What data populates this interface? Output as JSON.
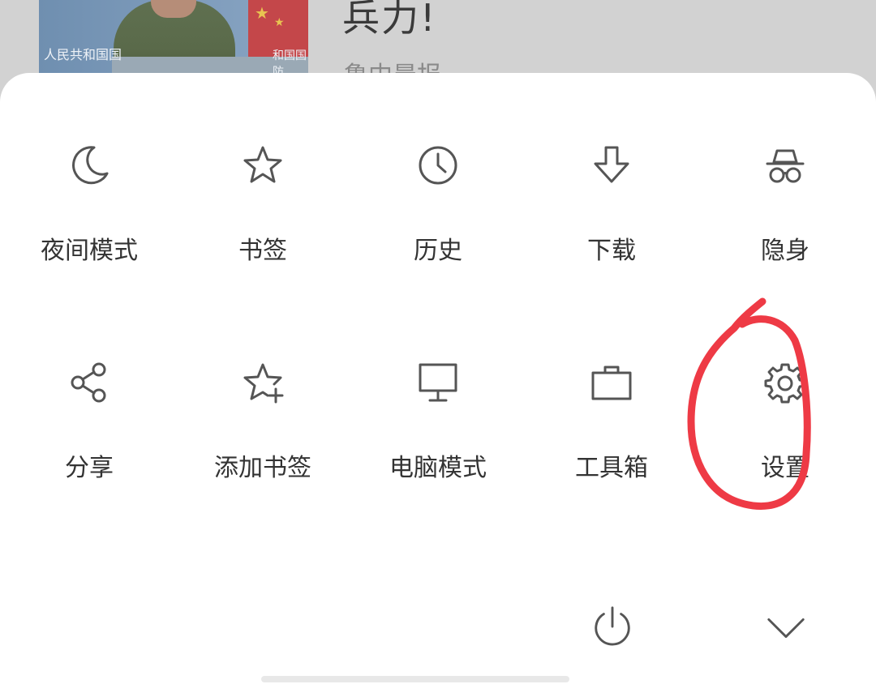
{
  "article": {
    "title": "兵力!",
    "source": "鲁中晨报",
    "thumb_caption_left": "人民共和国国",
    "thumb_caption_right": "和国国防"
  },
  "menu": {
    "row1": [
      {
        "label": "夜间模式",
        "icon": "moon-icon"
      },
      {
        "label": "书签",
        "icon": "star-icon"
      },
      {
        "label": "历史",
        "icon": "clock-icon"
      },
      {
        "label": "下载",
        "icon": "download-arrow-icon"
      },
      {
        "label": "隐身",
        "icon": "incognito-icon"
      }
    ],
    "row2": [
      {
        "label": "分享",
        "icon": "share-icon"
      },
      {
        "label": "添加书签",
        "icon": "star-plus-icon"
      },
      {
        "label": "电脑模式",
        "icon": "monitor-icon"
      },
      {
        "label": "工具箱",
        "icon": "toolbox-icon"
      },
      {
        "label": "设置",
        "icon": "gear-icon"
      }
    ],
    "bottom": [
      {
        "icon": "power-icon"
      },
      {
        "icon": "chevron-down-icon"
      }
    ]
  },
  "colors": {
    "icon": "#555555",
    "label": "#333333",
    "annotation": "#ee3a45",
    "sheet": "#ffffff",
    "backdrop": "#cfcfcf"
  }
}
